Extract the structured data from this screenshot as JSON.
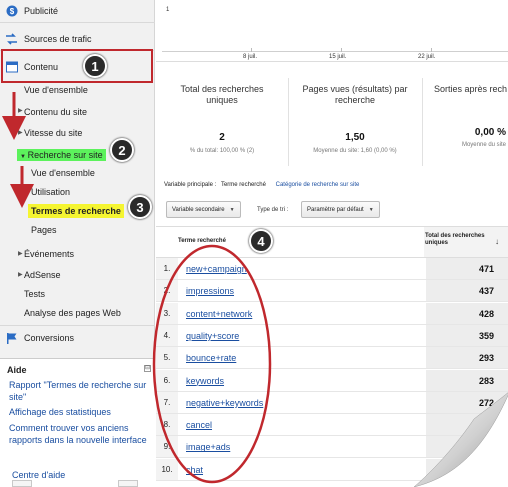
{
  "sidebar": {
    "publicite": "Publicité",
    "sources": "Sources de trafic",
    "contenu": "Contenu",
    "vue_ensemble": "Vue d'ensemble",
    "contenu_site": "Contenu du site",
    "vitesse_site": "Vitesse du site",
    "recherche_site": "Recherche sur site",
    "rs_vue_ensemble": "Vue d'ensemble",
    "utilisation": "Utilisation",
    "termes": "Termes de recherche",
    "pages": "Pages",
    "evenements": "Événements",
    "adsense": "AdSense",
    "tests": "Tests",
    "analyse_pages_web": "Analyse des pages Web",
    "conversions": "Conversions"
  },
  "aide": {
    "title": "Aide",
    "minimize": "⊟",
    "links": [
      "Rapport \"Termes de recherche sur site\"",
      "Affichage des statistiques",
      "Comment trouver vos anciens rapports dans la nouvelle interface",
      "Centre d'aide"
    ]
  },
  "chart": {
    "y_label": "1",
    "x_ticks": [
      "8 juil.",
      "15 juil.",
      "22 juil."
    ]
  },
  "metrics": [
    {
      "title": "Total des recherches uniques",
      "value": "2",
      "sub": "% du total: 100,00 % (2)"
    },
    {
      "title": "Pages vues (résultats) par recherche",
      "value": "1,50",
      "sub": "Moyenne du site: 1,60 (0,00 %)"
    },
    {
      "title": "Sorties après rech",
      "value": "0,00 %",
      "sub": "Moyenne du site"
    }
  ],
  "dimension": {
    "label": "Variable principale :",
    "current": "Terme recherché",
    "alternate": "Catégorie de recherche sur site"
  },
  "controls": {
    "secondary": "Variable secondaire",
    "sort_label": "Type de tri :",
    "sort_value": "Paramètre par défaut"
  },
  "table": {
    "col_term": "Terme recherché",
    "col_total": "Total des recherches uniques",
    "sort_icon": "↓",
    "rows": [
      {
        "n": "1.",
        "term": "new+campaign",
        "value": "471"
      },
      {
        "n": "2.",
        "term": "impressions",
        "value": "437"
      },
      {
        "n": "3.",
        "term": "content+network",
        "value": "428"
      },
      {
        "n": "4.",
        "term": "quality+score",
        "value": "359"
      },
      {
        "n": "5.",
        "term": "bounce+rate",
        "value": "293"
      },
      {
        "n": "6.",
        "term": "keywords",
        "value": "283"
      },
      {
        "n": "7.",
        "term": "negative+keywords",
        "value": "272"
      },
      {
        "n": "8.",
        "term": "cancel",
        "value": ""
      },
      {
        "n": "9.",
        "term": "image+ads",
        "value": ""
      },
      {
        "n": "10.",
        "term": "chat",
        "value": ""
      }
    ]
  },
  "annotations": [
    "1",
    "2",
    "3",
    "4"
  ],
  "colors": {
    "annotation_red": "#c0282d",
    "highlight_green": "#5cf25c",
    "highlight_yellow": "#f5f531",
    "link_blue": "#1a4ea0"
  }
}
